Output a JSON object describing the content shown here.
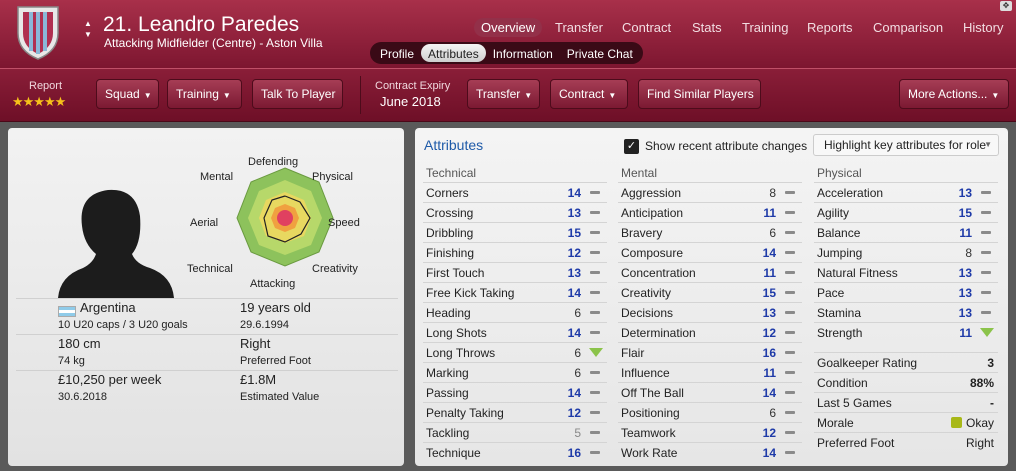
{
  "player": {
    "name": "21. Leandro Paredes",
    "role": "Attacking Midfielder (Centre) - Aston Villa"
  },
  "top_nav": [
    "Overview",
    "Transfer",
    "Contract",
    "Stats",
    "Training",
    "Reports",
    "Comparison",
    "History"
  ],
  "sub_tabs": [
    "Profile",
    "Attributes",
    "Information",
    "Private Chat"
  ],
  "toolbar": {
    "report_label": "Report",
    "stars": "★★★★★",
    "squad": "Squad",
    "training": "Training",
    "talk": "Talk To Player",
    "contract_label": "Contract Expiry",
    "contract_value": "June 2018",
    "transfer": "Transfer",
    "contract": "Contract",
    "similar": "Find Similar Players",
    "more": "More Actions..."
  },
  "radar": {
    "labels": {
      "top": "Defending",
      "tl": "Mental",
      "tr": "Physical",
      "l": "Aerial",
      "r": "Speed",
      "bl": "Technical",
      "br": "Creativity",
      "b": "Attacking"
    }
  },
  "profile": {
    "nation": "Argentina",
    "caps": "10 U20 caps / 3 U20 goals",
    "age": "19 years old",
    "dob": "29.6.1994",
    "height": "180 cm",
    "weight": "74 kg",
    "foot": "Right",
    "foot_label": "Preferred Foot",
    "wage": "£10,250 per week",
    "wage_date": "30.6.2018",
    "value": "£1.8M",
    "value_label": "Estimated Value"
  },
  "attrs": {
    "title": "Attributes",
    "show_changes": "Show recent attribute changes",
    "highlight": "Highlight key attributes for role",
    "technical_title": "Technical",
    "mental_title": "Mental",
    "physical_title": "Physical",
    "technical": [
      [
        "Corners",
        "14"
      ],
      [
        "Crossing",
        "13"
      ],
      [
        "Dribbling",
        "15"
      ],
      [
        "Finishing",
        "12"
      ],
      [
        "First Touch",
        "13"
      ],
      [
        "Free Kick Taking",
        "14"
      ],
      [
        "Heading",
        "6"
      ],
      [
        "Long Shots",
        "14"
      ],
      [
        "Long Throws",
        "6"
      ],
      [
        "Marking",
        "6"
      ],
      [
        "Passing",
        "14"
      ],
      [
        "Penalty Taking",
        "12"
      ],
      [
        "Tackling",
        "5"
      ],
      [
        "Technique",
        "16"
      ]
    ],
    "mental": [
      [
        "Aggression",
        "8"
      ],
      [
        "Anticipation",
        "11"
      ],
      [
        "Bravery",
        "6"
      ],
      [
        "Composure",
        "14"
      ],
      [
        "Concentration",
        "11"
      ],
      [
        "Creativity",
        "15"
      ],
      [
        "Decisions",
        "13"
      ],
      [
        "Determination",
        "12"
      ],
      [
        "Flair",
        "16"
      ],
      [
        "Influence",
        "11"
      ],
      [
        "Off The Ball",
        "14"
      ],
      [
        "Positioning",
        "6"
      ],
      [
        "Teamwork",
        "12"
      ],
      [
        "Work Rate",
        "14"
      ]
    ],
    "physical": [
      [
        "Acceleration",
        "13"
      ],
      [
        "Agility",
        "15"
      ],
      [
        "Balance",
        "11"
      ],
      [
        "Jumping",
        "8"
      ],
      [
        "Natural Fitness",
        "13"
      ],
      [
        "Pace",
        "13"
      ],
      [
        "Stamina",
        "13"
      ],
      [
        "Strength",
        "11"
      ]
    ],
    "stats": [
      [
        "Goalkeeper Rating",
        "3"
      ],
      [
        "Condition",
        "88%"
      ],
      [
        "Last 5 Games",
        "-"
      ],
      [
        "Morale",
        "Okay"
      ],
      [
        "Preferred Foot",
        "Right"
      ]
    ]
  }
}
